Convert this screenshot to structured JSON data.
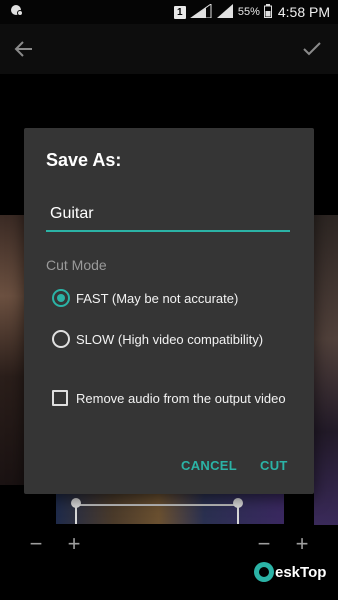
{
  "status_bar": {
    "sim": "1",
    "battery_percent": "55%",
    "time": "4:58 PM",
    "icons": [
      "notification-icon",
      "signal-icon",
      "battery-icon"
    ]
  },
  "toolbar": {
    "back_icon": "arrow-left-icon",
    "confirm_icon": "checkmark-icon"
  },
  "dialog": {
    "title": "Save As:",
    "filename_value": "Guitar",
    "cut_mode_label": "Cut Mode",
    "options": [
      {
        "label": "FAST (May be not accurate)",
        "selected": true
      },
      {
        "label": "SLOW (High video compatibility)",
        "selected": false
      }
    ],
    "remove_audio_label": "Remove audio from the output video",
    "remove_audio_checked": false,
    "cancel_label": "CANCEL",
    "cut_label": "CUT"
  },
  "zoom_controls": {
    "minus": "−",
    "plus": "+"
  },
  "watermark": {
    "text": "eskTop"
  },
  "colors": {
    "accent": "#2bb3a6",
    "dialog_bg": "#353535"
  }
}
